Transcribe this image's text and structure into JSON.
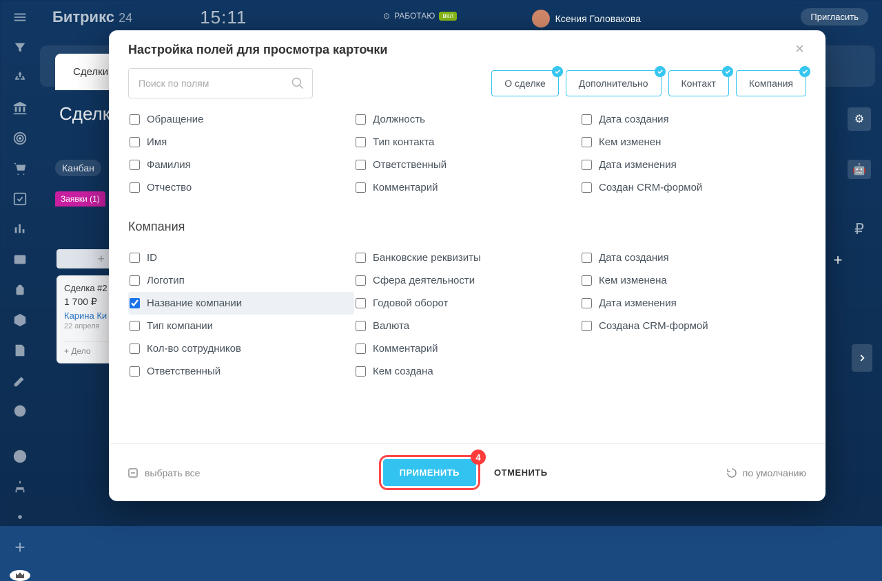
{
  "header": {
    "brand": "Битрикс",
    "brand_suffix": "24",
    "clock": "15:11",
    "work_status": "РАБОТАЮ",
    "work_badge": "вкл",
    "user_name": "Ксения Головакова",
    "invite_label": "Пригласить"
  },
  "background": {
    "tab_active": "Сделки",
    "page_title": "Сделк",
    "kanban": "Канбан",
    "zayavki": "Заявки (1)",
    "deal": {
      "title": "Сделка #2",
      "price": "1 700 ₽",
      "name": "Карина Ки",
      "date": "22 апреля",
      "action": "+ Дело"
    }
  },
  "modal": {
    "title": "Настройка полей для просмотра карточки",
    "search_placeholder": "Поиск по полям",
    "group_tabs": [
      "О сделке",
      "Дополнительно",
      "Контакт",
      "Компания"
    ],
    "sections": [
      {
        "title": "Контакт",
        "hide_title": true,
        "columns": [
          [
            {
              "label": "Обращение",
              "checked": false
            },
            {
              "label": "Имя",
              "checked": false
            },
            {
              "label": "Фамилия",
              "checked": false
            },
            {
              "label": "Отчество",
              "checked": false
            }
          ],
          [
            {
              "label": "Должность",
              "checked": false
            },
            {
              "label": "Тип контакта",
              "checked": false
            },
            {
              "label": "Ответственный",
              "checked": false
            },
            {
              "label": "Комментарий",
              "checked": false
            }
          ],
          [
            {
              "label": "Дата создания",
              "checked": false
            },
            {
              "label": "Кем изменен",
              "checked": false
            },
            {
              "label": "Дата изменения",
              "checked": false
            },
            {
              "label": "Создан CRM-формой",
              "checked": false
            }
          ]
        ]
      },
      {
        "title": "Компания",
        "hide_title": false,
        "columns": [
          [
            {
              "label": "ID",
              "checked": false
            },
            {
              "label": "Логотип",
              "checked": false
            },
            {
              "label": "Название компании",
              "checked": true
            },
            {
              "label": "Тип компании",
              "checked": false
            },
            {
              "label": "Кол-во сотрудников",
              "checked": false
            },
            {
              "label": "Ответственный",
              "checked": false
            }
          ],
          [
            {
              "label": "Банковские реквизиты",
              "checked": false
            },
            {
              "label": "Сфера деятельности",
              "checked": false
            },
            {
              "label": "Годовой оборот",
              "checked": false
            },
            {
              "label": "Валюта",
              "checked": false
            },
            {
              "label": "Комментарий",
              "checked": false
            },
            {
              "label": "Кем создана",
              "checked": false
            }
          ],
          [
            {
              "label": "Дата создания",
              "checked": false
            },
            {
              "label": "Кем изменена",
              "checked": false
            },
            {
              "label": "Дата изменения",
              "checked": false
            },
            {
              "label": "Создана CRM-формой",
              "checked": false
            }
          ]
        ]
      }
    ],
    "footer": {
      "select_all": "выбрать все",
      "apply": "ПРИМЕНИТЬ",
      "apply_badge": "4",
      "cancel": "ОТМЕНИТЬ",
      "default": "по умолчанию"
    }
  }
}
